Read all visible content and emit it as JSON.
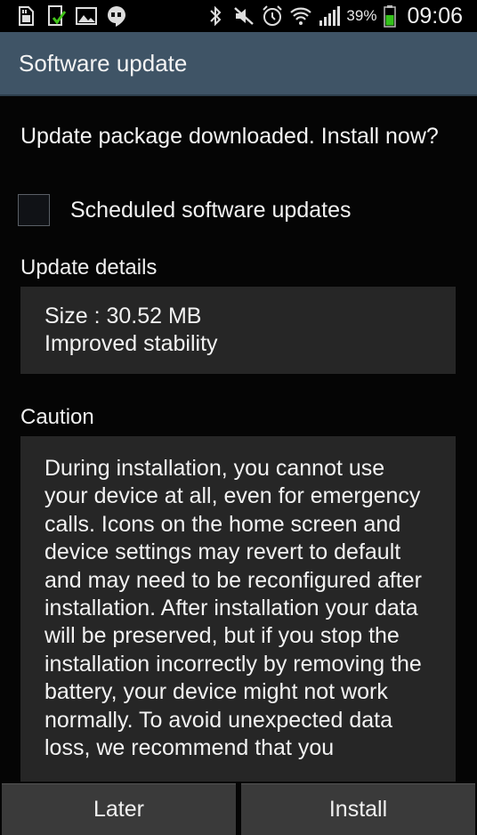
{
  "status_bar": {
    "left_icons": [
      "sd-card-icon",
      "download-complete-icon",
      "image-icon",
      "hangouts-icon"
    ],
    "right_icons": [
      "bluetooth-icon",
      "mute-icon",
      "alarm-icon",
      "wifi-icon",
      "signal-icon"
    ],
    "battery_percent": "39%",
    "time": "09:06",
    "battery_color": "#34c21a"
  },
  "action_bar": {
    "title": "Software update",
    "color": "#3f5466"
  },
  "content": {
    "prompt": "Update package downloaded. Install now?",
    "scheduled_checkbox": {
      "label": "Scheduled software updates",
      "checked": false
    },
    "details_label": "Update details",
    "details_lines": [
      "Size : 30.52 MB",
      "Improved stability"
    ],
    "caution_label": "Caution",
    "caution_text": "During installation, you cannot use your device at all, even for emergency calls. Icons on the home screen and device settings may revert to default and may need to be reconfigured after installation. After installation your data will be preserved, but if you stop the installation incorrectly by removing the battery, your device might not work normally. To avoid unexpected data loss, we recommend that you"
  },
  "buttons": {
    "later": "Later",
    "install": "Install"
  }
}
